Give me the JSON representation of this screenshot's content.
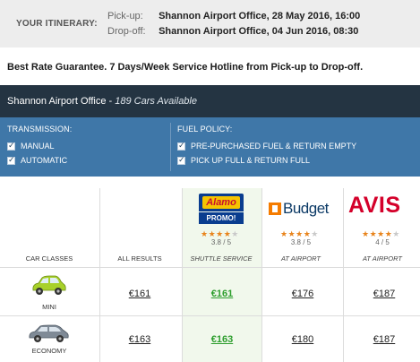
{
  "itinerary": {
    "label": "YOUR ITINERARY:",
    "pickup_key": "Pick-up:",
    "pickup_value": "Shannon Airport Office, 28 May 2016, 16:00",
    "dropoff_key": "Drop-off:",
    "dropoff_value": "Shannon Airport Office, 04 Jun 2016, 08:30"
  },
  "guarantee": "Best Rate Guarantee. 7 Days/Week Service Hotline from Pick-up to Drop-off.",
  "location": {
    "name": "Shannon Airport Office",
    "separator": " - ",
    "available": "189 Cars Available"
  },
  "filters": {
    "transmission": {
      "heading": "TRANSMISSION:",
      "options": [
        "MANUAL",
        "AUTOMATIC"
      ]
    },
    "fuel": {
      "heading": "FUEL POLICY:",
      "options": [
        "PRE-PURCHASED FUEL & RETURN EMPTY",
        "PICK UP FULL & RETURN FULL"
      ]
    }
  },
  "columns": {
    "car_classes": "CAR CLASSES",
    "all_results": "ALL RESULTS",
    "suppliers": [
      {
        "name": "Alamo",
        "badge": "PROMO!",
        "rating": "3.8 / 5",
        "stars": 4,
        "location": "SHUTTLE SERVICE"
      },
      {
        "name": "Budget",
        "rating": "3.8 / 5",
        "stars": 4,
        "location": "AT AIRPORT"
      },
      {
        "name": "AVIS",
        "rating": "4 / 5",
        "stars": 4,
        "location": "AT AIRPORT"
      }
    ]
  },
  "rows": [
    {
      "class": "MINI",
      "car_color": "#a8d12a",
      "all": "€161",
      "alamo": "€161",
      "budget": "€176",
      "avis": "€187"
    },
    {
      "class": "ECONOMY",
      "car_color": "#7f8a96",
      "all": "€163",
      "alamo": "€163",
      "budget": "€180",
      "avis": "€187"
    }
  ],
  "colors": {
    "header_dark": "#243442",
    "filter_blue": "#3f77a8",
    "best_price_green": "#2e9e2e",
    "star_orange": "#e8841c"
  }
}
